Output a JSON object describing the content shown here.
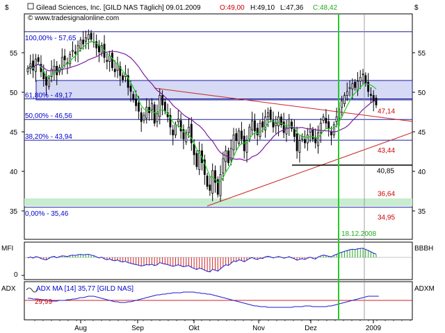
{
  "header": {
    "title": "Gilead Sciences, Inc. [GILD NAS  Täglich] 09.01.2009",
    "open": "O:49,00",
    "high": "H:49,10",
    "low": "L:47,36",
    "close": "C:48,42",
    "website": "www.tradesignalonline.com",
    "currency_left": "$",
    "currency_right": "$"
  },
  "colors": {
    "fib_line": "#1a1aa0",
    "fib_band": "#d4d8f4",
    "support_band": "#c8ecd0",
    "trend_line": "#cc2222",
    "ma_fast": "#22cc22",
    "ma_slow": "#7a1aa0",
    "marker_line": "#22cc22",
    "level_line": "#000000"
  },
  "chart_data": [
    {
      "type": "candlestick",
      "title": "Gilead Sciences, Inc. [GILD NAS  Täglich] 09.01.2009",
      "ylim": [
        32,
        60
      ],
      "yticks": [
        "35",
        "40",
        "45",
        "50",
        "55"
      ],
      "xticks": [
        "Aug",
        "Sep",
        "Okt",
        "Nov",
        "Dez",
        "2009"
      ],
      "fib_levels": [
        {
          "label": "100,00% - 57,65",
          "value": 57.65
        },
        {
          "label": "61,80% - 49,17",
          "value": 49.17
        },
        {
          "label": "50,00% - 46,56",
          "value": 46.56
        },
        {
          "label": "38,20% - 43,94",
          "value": 43.94
        },
        {
          "label": "0,00% - 35,46",
          "value": 35.46
        }
      ],
      "right_labels": [
        {
          "label": "47,14",
          "value": 47.14,
          "color": "red"
        },
        {
          "label": "43,44",
          "value": 43.44,
          "color": "red"
        },
        {
          "label": "40,85",
          "value": 40.85,
          "color": "black"
        },
        {
          "label": "36,64",
          "value": 36.64,
          "color": "red"
        },
        {
          "label": "34,95",
          "value": 34.95,
          "color": "red"
        }
      ],
      "marker_date": "18.12.2008",
      "closes": [
        53.0,
        53.6,
        52.8,
        54.2,
        53.9,
        52.6,
        51.7,
        50.9,
        51.8,
        52.9,
        53.3,
        52.2,
        53.1,
        54.4,
        54.1,
        53.6,
        54.8,
        55.3,
        54.9,
        55.9,
        56.6,
        56.1,
        56.9,
        57.3,
        56.7,
        56.4,
        55.6,
        55.1,
        55.9,
        54.4,
        53.9,
        54.6,
        53.1,
        52.6,
        53.6,
        52.1,
        51.6,
        52.3,
        50.6,
        50.1,
        49.1,
        48.3,
        47.6,
        46.3,
        47.1,
        48.1,
        47.4,
        48.6,
        46.1,
        47.3,
        49.6,
        48.4,
        47.6,
        46.9,
        45.6,
        44.6,
        45.9,
        46.6,
        45.1,
        44.1,
        44.9,
        45.6,
        43.6,
        42.1,
        40.6,
        42.6,
        41.1,
        39.6,
        38.1,
        37.6,
        40.1,
        38.6,
        37.1,
        39.6,
        41.6,
        42.6,
        41.1,
        42.9,
        44.6,
        43.9,
        45.1,
        44.1,
        42.6,
        43.9,
        45.6,
        46.4,
        45.1,
        44.6,
        46.1,
        45.6,
        46.9,
        47.4,
        46.6,
        45.6,
        46.1,
        46.9,
        45.9,
        44.9,
        45.6,
        46.6,
        45.4,
        44.4,
        42.6,
        43.9,
        44.4,
        43.6,
        44.6,
        45.4,
        44.1,
        43.6,
        44.9,
        46.1,
        46.9,
        46.1,
        45.4,
        44.6,
        45.9,
        46.9,
        47.9,
        48.9,
        49.6,
        50.1,
        50.6,
        51.1,
        50.6,
        51.4,
        51.9,
        52.3,
        51.1,
        50.1,
        49.6,
        48.9,
        48.4
      ],
      "ma_fast": [
        52.9,
        53.2,
        53.0,
        53.4,
        53.6,
        53.2,
        52.6,
        52.0,
        51.9,
        52.1,
        52.5,
        52.6,
        52.7,
        53.2,
        53.5,
        53.6,
        53.9,
        54.3,
        54.6,
        55.0,
        55.4,
        55.7,
        56.0,
        56.3,
        56.4,
        56.4,
        56.2,
        55.9,
        55.7,
        55.3,
        54.9,
        54.7,
        54.3,
        53.8,
        53.6,
        53.1,
        52.7,
        52.3,
        51.8,
        51.2,
        50.6,
        49.9,
        49.1,
        48.3,
        47.9,
        47.7,
        47.7,
        47.6,
        47.4,
        47.4,
        47.7,
        47.8,
        47.6,
        47.3,
        46.8,
        46.2,
        45.9,
        45.8,
        45.5,
        45.0,
        44.7,
        44.6,
        44.2,
        43.6,
        42.8,
        42.3,
        41.8,
        41.0,
        40.2,
        39.4,
        39.2,
        39.0,
        38.6,
        38.7,
        39.2,
        39.9,
        40.4,
        41.0,
        41.9,
        42.6,
        43.2,
        43.5,
        43.6,
        43.6,
        44.1,
        44.6,
        44.9,
        44.8,
        45.0,
        45.2,
        45.6,
        46.1,
        46.4,
        46.3,
        46.2,
        46.2,
        46.1,
        45.9,
        45.7,
        45.8,
        45.7,
        45.5,
        44.9,
        44.6,
        44.5,
        44.3,
        44.3,
        44.4,
        44.4,
        44.2,
        44.3,
        44.6,
        45.1,
        45.4,
        45.4,
        45.4,
        45.5,
        45.8,
        46.3,
        46.9,
        47.6,
        48.3,
        48.9,
        49.5,
        49.9,
        50.3,
        50.6,
        51.0,
        51.1,
        51.0,
        50.9,
        50.7,
        50.4
      ]
    },
    {
      "type": "bar",
      "title": "MFI",
      "ylabel_right": "BBBH",
      "yticks": [
        "0"
      ],
      "values": [
        -0.6,
        0.4,
        -0.8,
        0.8,
        0.2,
        -1.2,
        -2.0,
        -2.6,
        -1.0,
        0.6,
        1.1,
        -0.4,
        0.7,
        1.6,
        1.4,
        0.9,
        1.9,
        2.4,
        2.0,
        2.8,
        3.2,
        2.6,
        3.0,
        3.3,
        2.4,
        1.8,
        0.6,
        -0.6,
        0.2,
        -1.6,
        -2.4,
        -1.6,
        -3.0,
        -3.6,
        -2.6,
        -4.2,
        -4.8,
        -4.0,
        -5.6,
        -6.2,
        -7.0,
        -7.6,
        -8.2,
        -9.0,
        -8.4,
        -7.6,
        -8.0,
        -7.2,
        -8.6,
        -7.8,
        -5.4,
        -6.4,
        -7.0,
        -7.6,
        -8.6,
        -9.4,
        -8.6,
        -7.8,
        -8.8,
        -9.8,
        -9.2,
        -8.6,
        -10.4,
        -11.6,
        -12.8,
        -11.2,
        -12.0,
        -13.4,
        -14.6,
        -15.2,
        -12.6,
        -13.4,
        -14.4,
        -12.0,
        -9.6,
        -7.8,
        -8.4,
        -6.2,
        -3.8,
        -4.4,
        -2.6,
        -3.2,
        -4.6,
        -3.0,
        -1.2,
        -0.2,
        -1.6,
        -2.2,
        -0.8,
        -1.2,
        0.6,
        1.2,
        0.4,
        -0.6,
        0.2,
        1.0,
        0.2,
        -0.8,
        -0.2,
        0.8,
        -0.4,
        -1.4,
        -3.0,
        -2.0,
        -1.4,
        -2.2,
        -0.8,
        0.2,
        -1.0,
        -1.8,
        0.4,
        1.6,
        2.4,
        1.8,
        1.2,
        0.6,
        2.2,
        3.2,
        4.4,
        5.4,
        6.4,
        7.2,
        8.0,
        8.6,
        8.2,
        9.0,
        9.4,
        9.6,
        8.4,
        7.2,
        5.8,
        4.4,
        3.4
      ]
    },
    {
      "type": "line",
      "title": "ADX MA [14] 35,77 [GILD NAS]",
      "ylabel_right": "ADXM",
      "reference": {
        "label": "29,99",
        "value": 29.99
      },
      "ylim": [
        5,
        55
      ],
      "values": [
        33,
        33,
        32,
        32,
        32,
        31,
        31,
        30,
        30,
        29,
        29,
        29,
        30,
        30,
        30,
        31,
        31,
        32,
        32,
        33,
        34,
        34,
        35,
        36,
        36,
        36,
        35,
        34,
        33,
        32,
        31,
        30,
        29,
        28,
        28,
        27,
        27,
        27,
        28,
        28,
        29,
        30,
        31,
        32,
        33,
        34,
        35,
        36,
        37,
        38,
        38,
        39,
        39,
        40,
        40,
        41,
        41,
        41,
        41,
        42,
        42,
        42,
        42,
        42,
        41,
        41,
        40,
        40,
        39,
        39,
        38,
        37,
        36,
        35,
        34,
        33,
        32,
        31,
        30,
        29,
        28,
        27,
        26,
        25,
        24,
        23,
        22,
        22,
        21,
        21,
        21,
        20,
        20,
        20,
        20,
        20,
        20,
        20,
        20,
        20,
        20,
        21,
        21,
        21,
        21,
        22,
        22,
        22,
        21,
        21,
        21,
        21,
        21,
        21,
        22,
        22,
        23,
        24,
        25,
        26,
        27,
        28,
        29,
        30,
        31,
        32,
        33,
        34,
        35,
        36,
        36,
        36,
        36,
        36
      ]
    }
  ],
  "panels": {
    "mfi_label": "MFI",
    "mfi_right": "BBBH",
    "adx_label": "ADX",
    "adx_right": "ADXM"
  }
}
